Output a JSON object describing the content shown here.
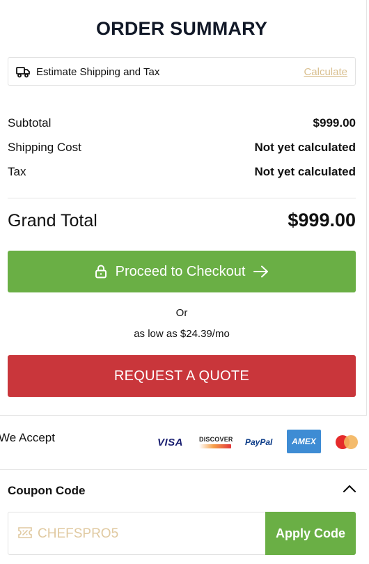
{
  "summary": {
    "title": "ORDER SUMMARY",
    "shipping_estimate": {
      "label": "Estimate Shipping and Tax",
      "action": "Calculate",
      "icon": "truck-icon"
    },
    "rows": [
      {
        "label": "Subtotal",
        "value": "$999.00"
      },
      {
        "label": "Shipping Cost",
        "value": "Not yet calculated"
      },
      {
        "label": "Tax",
        "value": "Not yet calculated"
      }
    ],
    "grand_total": {
      "label": "Grand Total",
      "value": "$999.00"
    },
    "checkout_button": {
      "label": "Proceed to Checkout",
      "icon_left": "lock-icon",
      "icon_right": "arrow-right-icon",
      "color": "#6aaf45"
    },
    "or_text": "Or",
    "financing_text": "as low as $24.39/mo",
    "quote_button": {
      "label": "REQUEST A QUOTE",
      "color": "#c9363b"
    }
  },
  "payments": {
    "label": "We Accept",
    "methods": [
      {
        "name": "VISA",
        "icon": "visa-icon"
      },
      {
        "name": "DISCOVER",
        "icon": "discover-icon"
      },
      {
        "name": "PayPal",
        "icon": "paypal-icon"
      },
      {
        "name": "AMEX",
        "icon": "amex-icon"
      },
      {
        "name": "Mastercard",
        "icon": "mastercard-icon"
      }
    ]
  },
  "coupon": {
    "title": "Coupon Code",
    "toggle_icon": "chevron-up-icon",
    "placeholder": "CHEFSPRO5",
    "input_icon": "coupon-tag-icon",
    "apply_label": "Apply Code"
  },
  "colors": {
    "accent_green": "#6aaf45",
    "accent_red": "#c9363b",
    "link_tan": "#d9bf8f"
  }
}
